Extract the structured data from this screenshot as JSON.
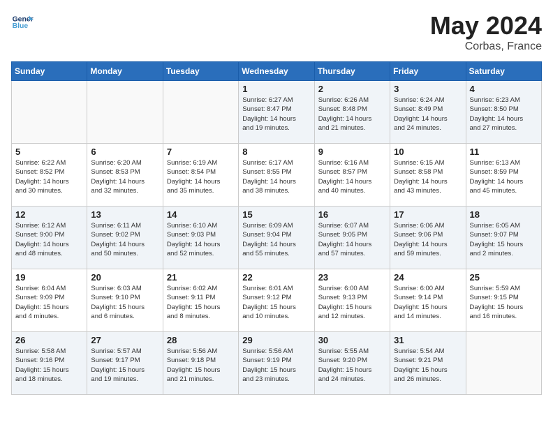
{
  "header": {
    "logo_general": "General",
    "logo_blue": "Blue",
    "month": "May 2024",
    "location": "Corbas, France"
  },
  "weekdays": [
    "Sunday",
    "Monday",
    "Tuesday",
    "Wednesday",
    "Thursday",
    "Friday",
    "Saturday"
  ],
  "weeks": [
    [
      {
        "day": "",
        "info": "",
        "empty": true
      },
      {
        "day": "",
        "info": "",
        "empty": true
      },
      {
        "day": "",
        "info": "",
        "empty": true
      },
      {
        "day": "1",
        "info": "Sunrise: 6:27 AM\nSunset: 8:47 PM\nDaylight: 14 hours\nand 19 minutes."
      },
      {
        "day": "2",
        "info": "Sunrise: 6:26 AM\nSunset: 8:48 PM\nDaylight: 14 hours\nand 21 minutes."
      },
      {
        "day": "3",
        "info": "Sunrise: 6:24 AM\nSunset: 8:49 PM\nDaylight: 14 hours\nand 24 minutes."
      },
      {
        "day": "4",
        "info": "Sunrise: 6:23 AM\nSunset: 8:50 PM\nDaylight: 14 hours\nand 27 minutes."
      }
    ],
    [
      {
        "day": "5",
        "info": "Sunrise: 6:22 AM\nSunset: 8:52 PM\nDaylight: 14 hours\nand 30 minutes."
      },
      {
        "day": "6",
        "info": "Sunrise: 6:20 AM\nSunset: 8:53 PM\nDaylight: 14 hours\nand 32 minutes."
      },
      {
        "day": "7",
        "info": "Sunrise: 6:19 AM\nSunset: 8:54 PM\nDaylight: 14 hours\nand 35 minutes."
      },
      {
        "day": "8",
        "info": "Sunrise: 6:17 AM\nSunset: 8:55 PM\nDaylight: 14 hours\nand 38 minutes."
      },
      {
        "day": "9",
        "info": "Sunrise: 6:16 AM\nSunset: 8:57 PM\nDaylight: 14 hours\nand 40 minutes."
      },
      {
        "day": "10",
        "info": "Sunrise: 6:15 AM\nSunset: 8:58 PM\nDaylight: 14 hours\nand 43 minutes."
      },
      {
        "day": "11",
        "info": "Sunrise: 6:13 AM\nSunset: 8:59 PM\nDaylight: 14 hours\nand 45 minutes."
      }
    ],
    [
      {
        "day": "12",
        "info": "Sunrise: 6:12 AM\nSunset: 9:00 PM\nDaylight: 14 hours\nand 48 minutes."
      },
      {
        "day": "13",
        "info": "Sunrise: 6:11 AM\nSunset: 9:02 PM\nDaylight: 14 hours\nand 50 minutes."
      },
      {
        "day": "14",
        "info": "Sunrise: 6:10 AM\nSunset: 9:03 PM\nDaylight: 14 hours\nand 52 minutes."
      },
      {
        "day": "15",
        "info": "Sunrise: 6:09 AM\nSunset: 9:04 PM\nDaylight: 14 hours\nand 55 minutes."
      },
      {
        "day": "16",
        "info": "Sunrise: 6:07 AM\nSunset: 9:05 PM\nDaylight: 14 hours\nand 57 minutes."
      },
      {
        "day": "17",
        "info": "Sunrise: 6:06 AM\nSunset: 9:06 PM\nDaylight: 14 hours\nand 59 minutes."
      },
      {
        "day": "18",
        "info": "Sunrise: 6:05 AM\nSunset: 9:07 PM\nDaylight: 15 hours\nand 2 minutes."
      }
    ],
    [
      {
        "day": "19",
        "info": "Sunrise: 6:04 AM\nSunset: 9:09 PM\nDaylight: 15 hours\nand 4 minutes."
      },
      {
        "day": "20",
        "info": "Sunrise: 6:03 AM\nSunset: 9:10 PM\nDaylight: 15 hours\nand 6 minutes."
      },
      {
        "day": "21",
        "info": "Sunrise: 6:02 AM\nSunset: 9:11 PM\nDaylight: 15 hours\nand 8 minutes."
      },
      {
        "day": "22",
        "info": "Sunrise: 6:01 AM\nSunset: 9:12 PM\nDaylight: 15 hours\nand 10 minutes."
      },
      {
        "day": "23",
        "info": "Sunrise: 6:00 AM\nSunset: 9:13 PM\nDaylight: 15 hours\nand 12 minutes."
      },
      {
        "day": "24",
        "info": "Sunrise: 6:00 AM\nSunset: 9:14 PM\nDaylight: 15 hours\nand 14 minutes."
      },
      {
        "day": "25",
        "info": "Sunrise: 5:59 AM\nSunset: 9:15 PM\nDaylight: 15 hours\nand 16 minutes."
      }
    ],
    [
      {
        "day": "26",
        "info": "Sunrise: 5:58 AM\nSunset: 9:16 PM\nDaylight: 15 hours\nand 18 minutes."
      },
      {
        "day": "27",
        "info": "Sunrise: 5:57 AM\nSunset: 9:17 PM\nDaylight: 15 hours\nand 19 minutes."
      },
      {
        "day": "28",
        "info": "Sunrise: 5:56 AM\nSunset: 9:18 PM\nDaylight: 15 hours\nand 21 minutes."
      },
      {
        "day": "29",
        "info": "Sunrise: 5:56 AM\nSunset: 9:19 PM\nDaylight: 15 hours\nand 23 minutes."
      },
      {
        "day": "30",
        "info": "Sunrise: 5:55 AM\nSunset: 9:20 PM\nDaylight: 15 hours\nand 24 minutes."
      },
      {
        "day": "31",
        "info": "Sunrise: 5:54 AM\nSunset: 9:21 PM\nDaylight: 15 hours\nand 26 minutes."
      },
      {
        "day": "",
        "info": "",
        "empty": true
      }
    ]
  ]
}
